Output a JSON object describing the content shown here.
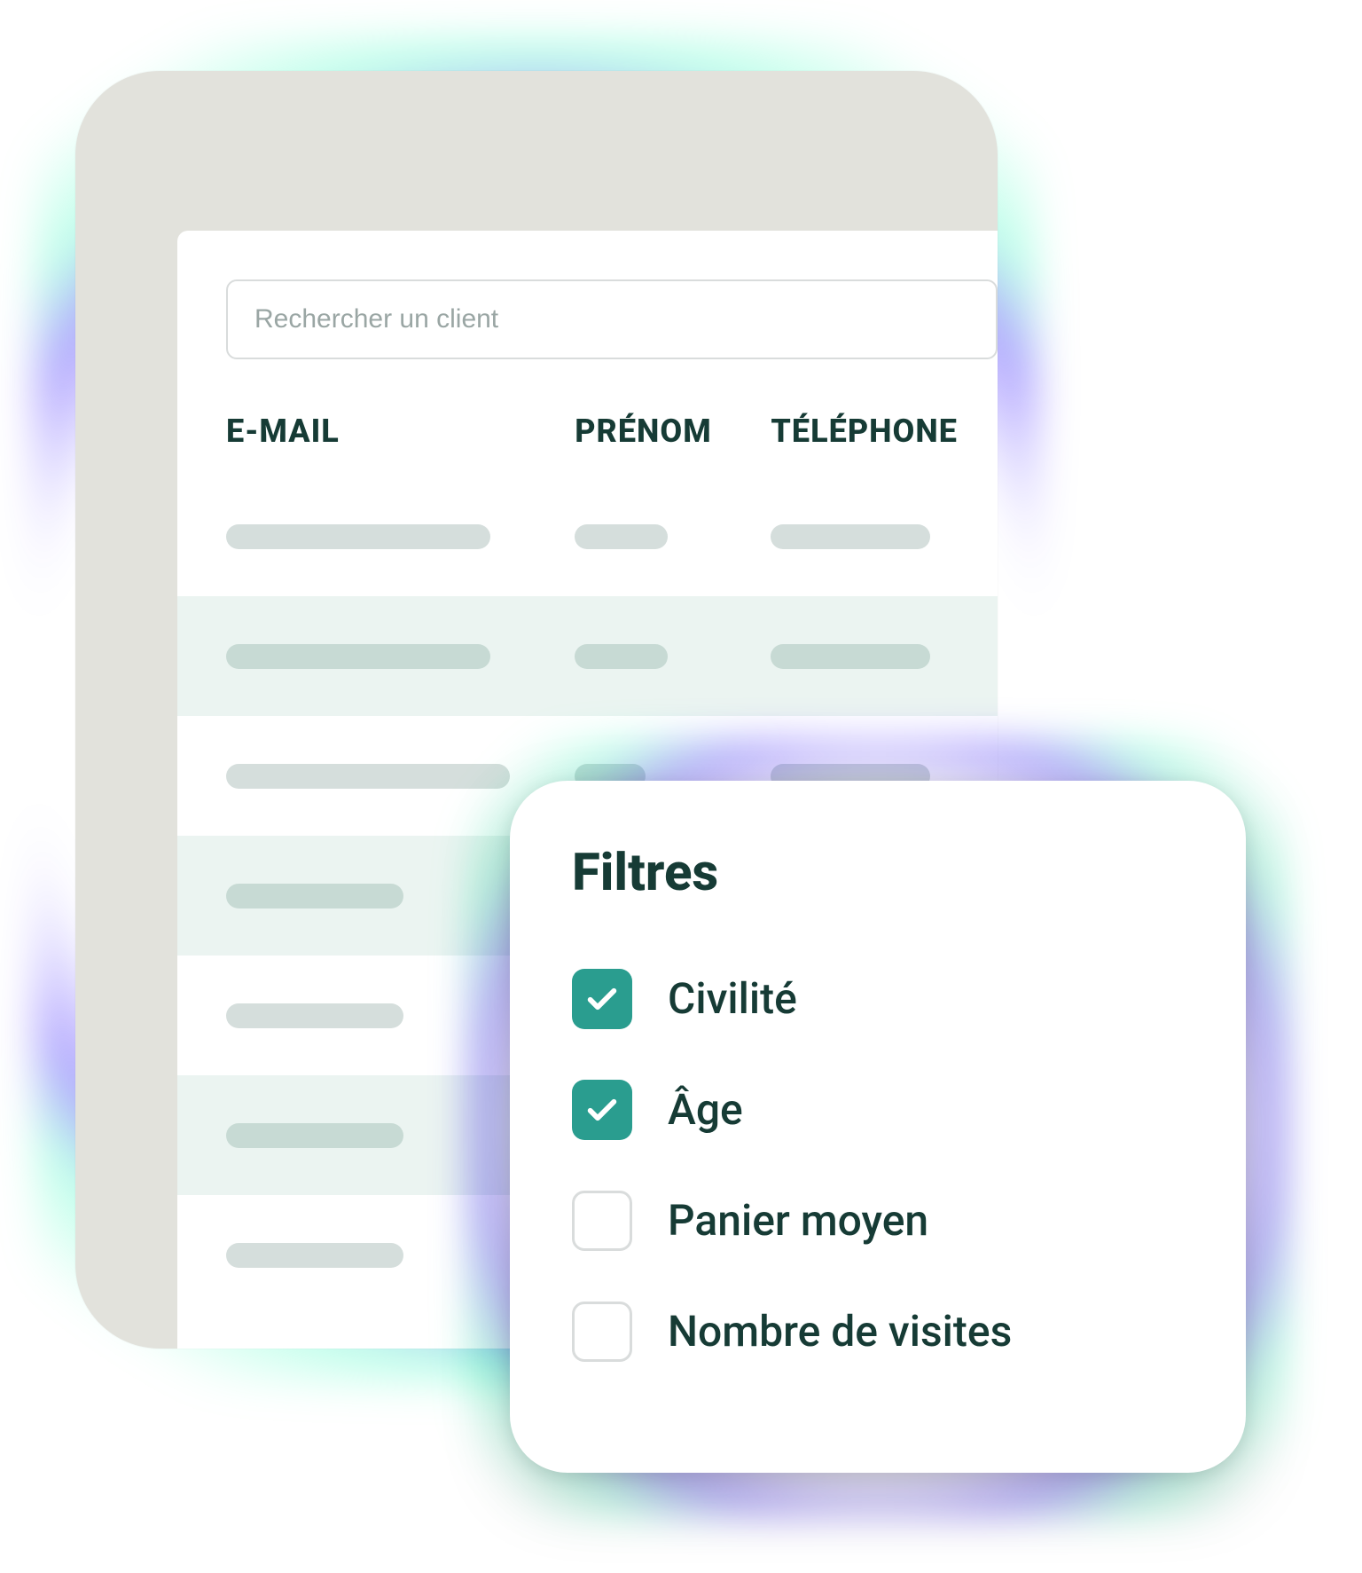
{
  "search": {
    "placeholder": "Rechercher un client"
  },
  "table": {
    "headers": {
      "email": "E-MAIL",
      "prenom": "PRÉNOM",
      "telephone": "TÉLÉPHONE"
    }
  },
  "filters": {
    "title": "Filtres",
    "items": [
      {
        "label": "Civilité",
        "checked": true
      },
      {
        "label": "Âge",
        "checked": true
      },
      {
        "label": "Panier moyen",
        "checked": false
      },
      {
        "label": "Nombre de visites",
        "checked": false
      }
    ]
  }
}
